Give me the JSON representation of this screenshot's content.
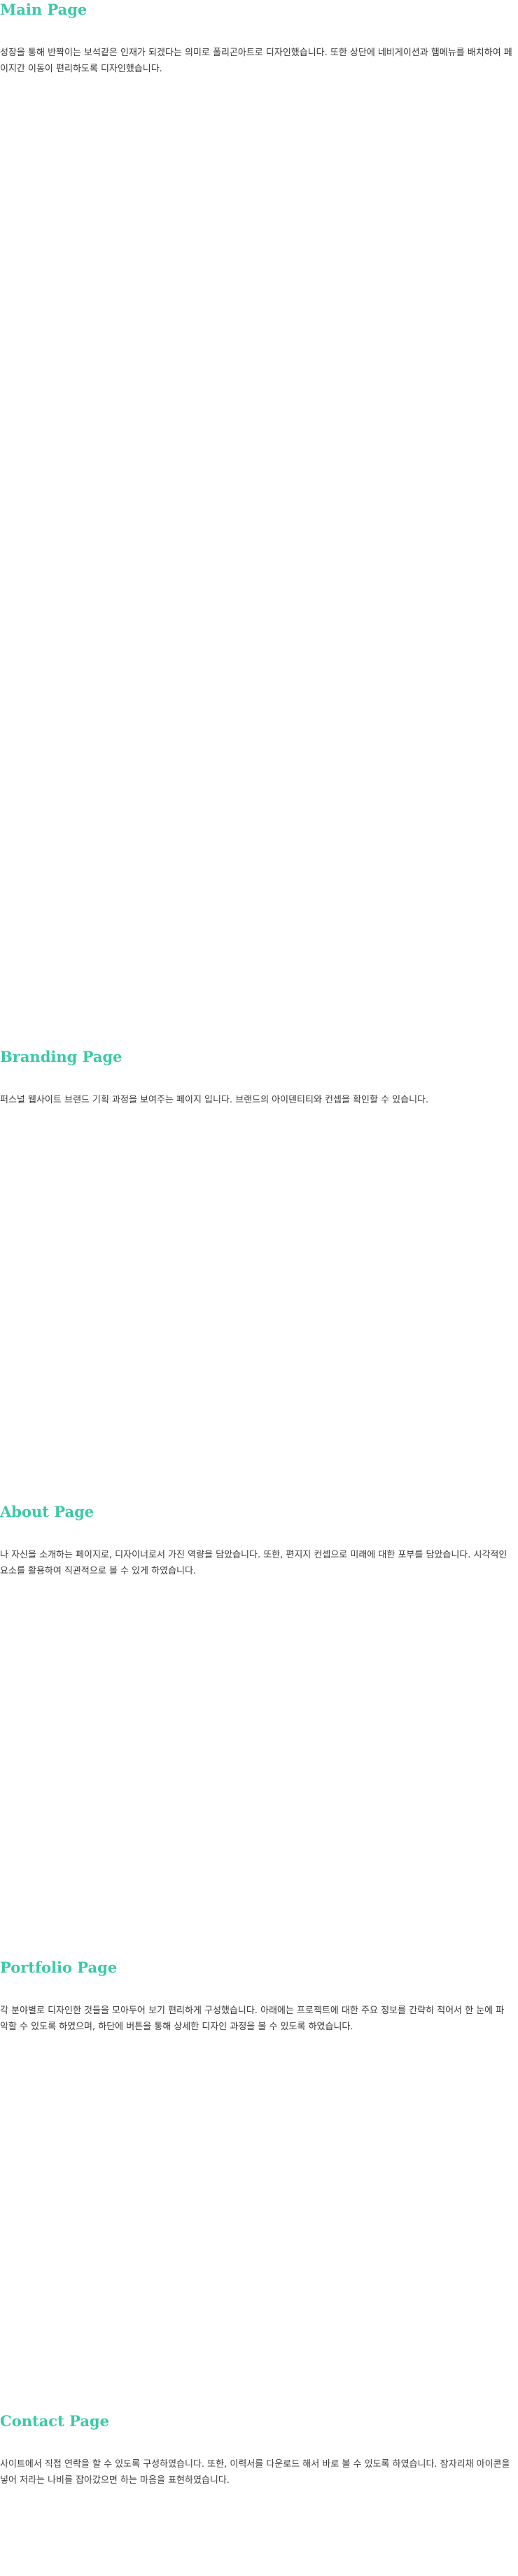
{
  "sections": {
    "main": {
      "title": "Main Page",
      "description": "성장을 통해 반짝이는 보석같은 인재가 되겠다는 의미로 폴리곤아트로 디자인했습니다. 또한 상단에 네비게이션과 햄메뉴를 배치하여 페이지간 이동이 편리하도록 디자인했습니다."
    },
    "branding": {
      "title": "Branding Page",
      "description": "퍼스널 웹사이트 브랜드 기획 과정을 보여주는 페이지 입니다. 브랜드의 아이덴티티와 컨셉을 확인할 수 있습니다."
    },
    "about": {
      "title": "About Page",
      "description": "나 자신을 소개하는 페이지로, 디자이너로서 가진 역량을 담았습니다. 또한, 편지지 컨셉으로 미래에 대한 포부를 담았습니다. 시각적인 요소를 활용하여 직관적으로 볼 수 있게 하였습니다."
    },
    "portfolio": {
      "title": "Portfolio Page",
      "description": "각 분야별로 디자인한 것들을 모아두어 보기 편리하게 구성했습니다. 아래에는 프로젝트에 대한 주요 정보를 간략히 적어서 한 눈에 파악할 수 있도록 하였으며, 하단에 버튼을 통해 상세한 디자인 과정을 볼 수 있도록 하였습니다."
    },
    "contact": {
      "title": "Contact Page",
      "description": "사이트에서 직접 연락을 할 수 있도록 구성하였습니다. 또한, 이력서를 다운로드 해서 바로 볼 수 있도록 하였습니다. 잠자리채 아이콘을 넣어 저라는 나비를 잡아갔으면 하는 마음을 표현하였습니다."
    }
  },
  "colors": {
    "accent": "#3cc9a8",
    "text": "#3a3a3a",
    "background": "#ffffff"
  }
}
